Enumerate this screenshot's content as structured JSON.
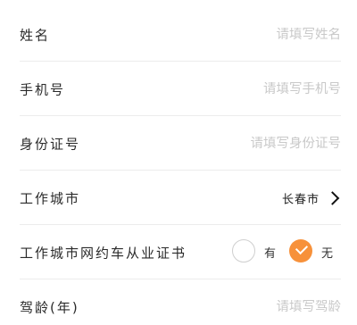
{
  "form": {
    "name": {
      "label": "姓名",
      "placeholder": "请填写姓名",
      "value": ""
    },
    "phone": {
      "label": "手机号",
      "placeholder": "请填写手机号",
      "value": ""
    },
    "id_number": {
      "label": "身份证号",
      "placeholder": "请填写身份证号",
      "value": ""
    },
    "work_city": {
      "label": "工作城市",
      "value": "长春市",
      "icon": "chevron-right-icon"
    },
    "ride_hailing_cert": {
      "label": "工作城市网约车从业证书",
      "options": [
        {
          "label": "有",
          "selected": false
        },
        {
          "label": "无",
          "selected": true
        }
      ],
      "accent_color": "#f7913a"
    },
    "driving_years": {
      "label": "驾龄(年)",
      "placeholder": "请填写驾龄",
      "value": ""
    }
  }
}
